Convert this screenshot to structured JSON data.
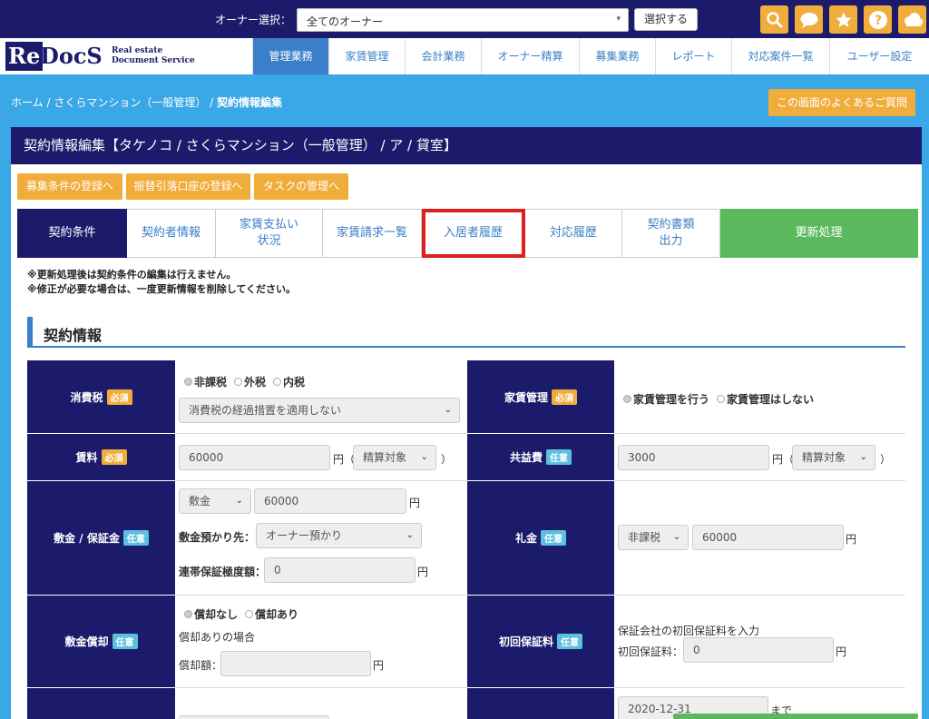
{
  "top": {
    "owner_label": "オーナー選択：",
    "owner_value": "全てのオーナー",
    "select_button": "選択する",
    "icons": [
      "search-icon",
      "chat-icon",
      "star-icon",
      "help-icon",
      "cloud-icon"
    ],
    "accent": "#f0ad3c",
    "navy": "#1c1b6b"
  },
  "logo": {
    "re": "Re",
    "docs": "DocS",
    "sub1": "Real estate",
    "sub2": "Document Service"
  },
  "nav": [
    {
      "label": "管理業務",
      "active": true
    },
    {
      "label": "家賃管理"
    },
    {
      "label": "会計業務"
    },
    {
      "label": "オーナー精算"
    },
    {
      "label": "募集業務"
    },
    {
      "label": "レポート"
    },
    {
      "label": "対応案件一覧"
    },
    {
      "label": "ユーザー設定"
    }
  ],
  "breadcrumb": {
    "home": "ホーム",
    "sep": " / ",
    "property": "さくらマンション（一般管理）",
    "current": "契約情報編集"
  },
  "faq_button": "この画面のよくあるご質問",
  "page_title": "契約情報編集【タケノコ / さくらマンション（一般管理） / ア / 貸室】",
  "actions": [
    "募集条件の登録へ",
    "振替引落口座の登録へ",
    "タスクの管理へ"
  ],
  "tabs": [
    {
      "label": "契約条件",
      "active": true
    },
    {
      "label": "契約者情報"
    },
    {
      "label": "家賃支払い\n状況"
    },
    {
      "label": "家賃請求一覧"
    },
    {
      "label": "入居者履歴",
      "highlighted": true
    },
    {
      "label": "対応履歴"
    },
    {
      "label": "契約書類\n出力"
    },
    {
      "label": "更新処理",
      "renew": true
    }
  ],
  "notes": [
    "※更新処理後は契約条件の編集は行えません。",
    "※修正が必要な場合は、一度更新情報を削除してください。"
  ],
  "section_title": "契約情報",
  "badges": {
    "required": "必須",
    "optional": "任意"
  },
  "form": {
    "tax": {
      "label": "消費税",
      "radios": [
        "非課税",
        "外税",
        "内税"
      ],
      "selected": "非課税",
      "select": "消費税の経過措置を適用しない"
    },
    "rent_mgmt": {
      "label": "家賃管理",
      "radios": [
        "家賃管理を行う",
        "家賃管理はしない"
      ],
      "selected": "家賃管理を行う"
    },
    "rent": {
      "label": "賃料",
      "value": "60000",
      "unit": "円（",
      "select": "精算対象",
      "close": "）"
    },
    "common_fee": {
      "label": "共益費",
      "value": "3000",
      "unit": "円（",
      "select": "精算対象",
      "close": "）"
    },
    "deposit": {
      "label": "敷金 / 保証金",
      "type_select": "敷金",
      "value": "60000",
      "unit": "円",
      "holder_label": "敷金預かり先：",
      "holder_select": "オーナー預かり",
      "guarantee_label": "連帯保証極度額：",
      "guarantee_value": "0",
      "guarantee_unit": "円"
    },
    "key_money": {
      "label": "礼金",
      "tax_select": "非課税",
      "value": "60000",
      "unit": "円"
    },
    "amortization": {
      "label": "敷金償却",
      "radios": [
        "償却なし",
        "償却あり"
      ],
      "selected": "償却なし",
      "note": "償却ありの場合",
      "amount_label": "償却額：",
      "unit": "円"
    },
    "guarantee_fee": {
      "label": "初回保証料",
      "note": "保証会社の初回保証料を入力",
      "amount_label": "初回保証料：",
      "value": "0",
      "unit": "円"
    },
    "period": {
      "date": "2020-12-31",
      "suffix": "まで"
    }
  }
}
